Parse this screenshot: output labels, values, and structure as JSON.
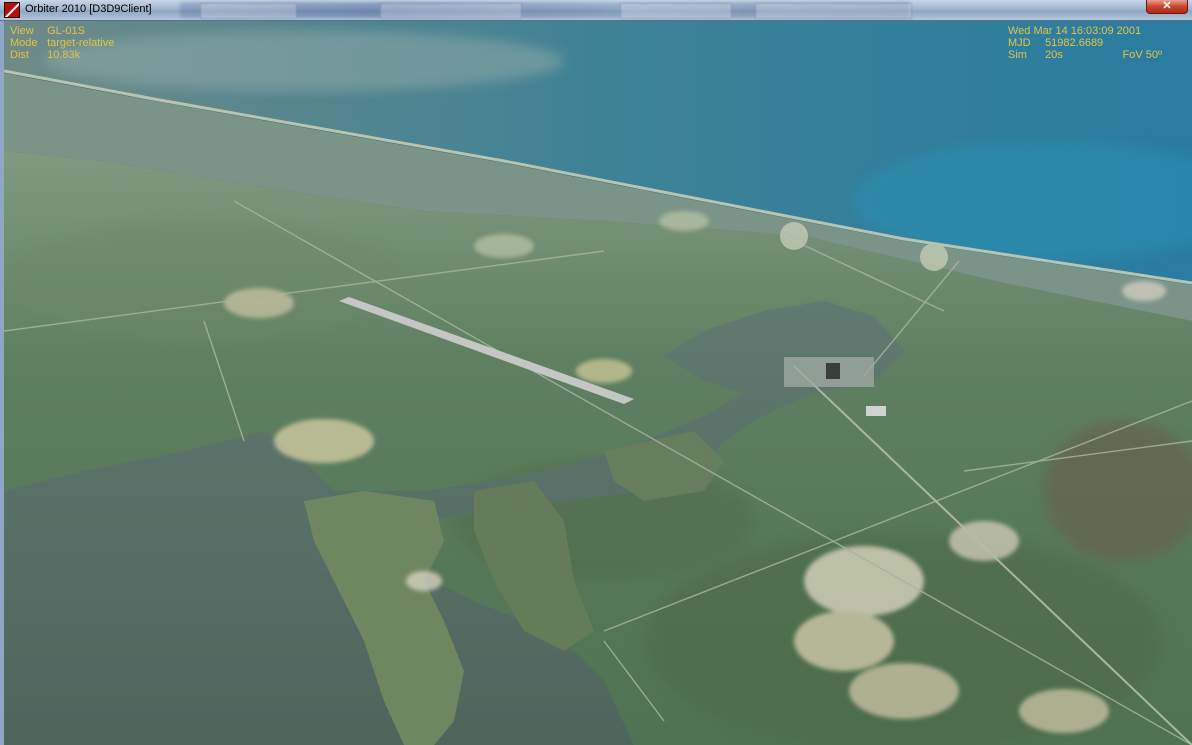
{
  "window": {
    "title": "Orbiter 2010 [D3D9Client]",
    "close_label": "✕"
  },
  "hud": {
    "view_label": "View",
    "view_value": "GL-01S",
    "mode_label": "Mode",
    "mode_value": "target-relative",
    "dist_label": "Dist",
    "dist_value": "10.83k",
    "date": "Wed Mar 14 16:03:09 2001",
    "mjd_label": "MJD",
    "mjd_value": "51982.6689",
    "sim_label": "Sim",
    "sim_value": "20s",
    "fov_label": "FoV",
    "fov_value": "50º"
  },
  "colors": {
    "hud_text": "#e0c44a",
    "ocean": "#2e7a90",
    "land": "#587a5a",
    "water": "#556e66"
  }
}
